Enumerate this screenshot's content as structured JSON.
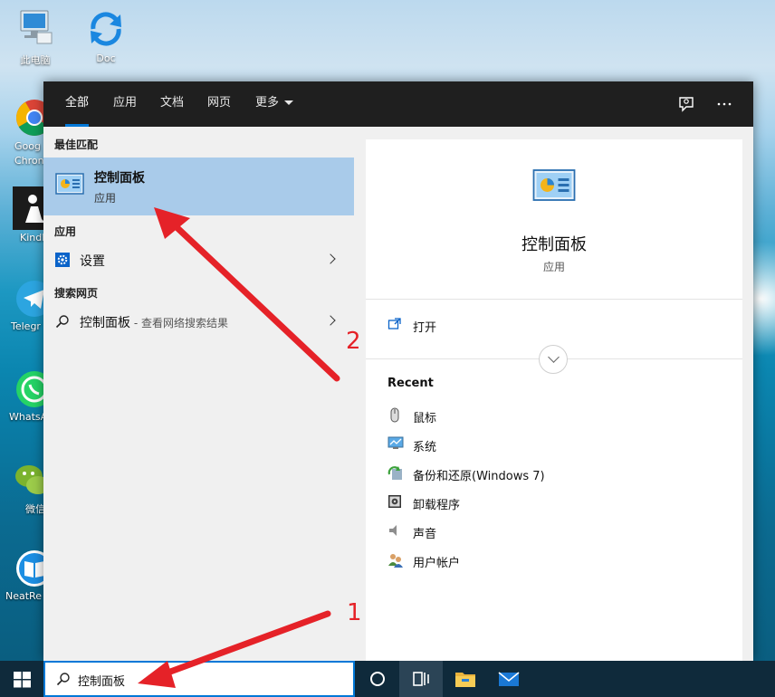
{
  "desktop": {
    "icons": [
      {
        "label": "此电脑",
        "name": "this-pc"
      },
      {
        "label": "Doc",
        "name": "doc"
      },
      {
        "label": "Goog Chron",
        "name": "google-chrome"
      },
      {
        "label": "Kindl",
        "name": "kindle"
      },
      {
        "label": "Telegr",
        "name": "telegram"
      },
      {
        "label": "WhatsA",
        "name": "whatsapp"
      },
      {
        "label": "微信",
        "name": "wechat"
      },
      {
        "label": "NeatRe",
        "name": "neatreader"
      }
    ]
  },
  "search_panel": {
    "tabs": [
      {
        "label": "全部",
        "active": true
      },
      {
        "label": "应用"
      },
      {
        "label": "文档"
      },
      {
        "label": "网页"
      },
      {
        "label": "更多"
      }
    ],
    "top_icons": [
      "feedback-icon",
      "more-options-icon"
    ],
    "best_match": {
      "section_title": "最佳匹配",
      "title": "控制面板",
      "subtitle": "应用",
      "icon": "control-panel-icon"
    },
    "apps": {
      "section_title": "应用",
      "items": [
        {
          "label": "设置",
          "icon": "settings-gear-icon"
        }
      ]
    },
    "web": {
      "section_title": "搜索网页",
      "items": [
        {
          "label": "控制面板",
          "sub": " - 查看网络搜索结果",
          "icon": "search-icon"
        }
      ]
    },
    "detail": {
      "title": "控制面板",
      "subtitle": "应用",
      "icon": "control-panel-icon",
      "actions": [
        {
          "label": "打开",
          "icon": "open-icon"
        }
      ],
      "recent_title": "Recent",
      "recent": [
        {
          "label": "鼠标",
          "icon": "mouse-icon"
        },
        {
          "label": "系统",
          "icon": "system-monitor-icon"
        },
        {
          "label": "备份和还原(Windows 7)",
          "icon": "backup-restore-icon"
        },
        {
          "label": "卸载程序",
          "icon": "uninstall-program-icon"
        },
        {
          "label": "声音",
          "icon": "speaker-icon"
        },
        {
          "label": "用户帐户",
          "icon": "user-accounts-icon"
        }
      ]
    }
  },
  "taskbar": {
    "search_value": "控制面板",
    "buttons": [
      "start-icon",
      "cortana-icon",
      "task-view-icon",
      "file-explorer-icon",
      "mail-icon"
    ]
  },
  "annotations": {
    "marker_1": "1",
    "marker_2": "2",
    "color": "#e52228"
  }
}
